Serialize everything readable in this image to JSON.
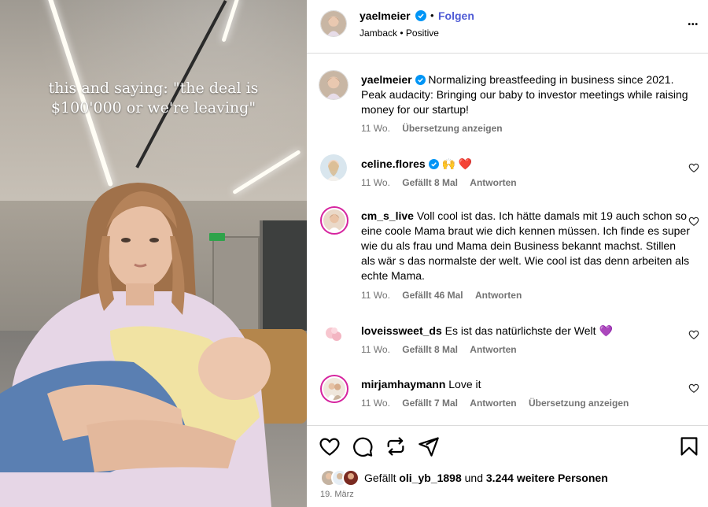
{
  "video": {
    "overlay_text": "this and saying: \"the deal is $100'000 or we're leaving\""
  },
  "header": {
    "username": "yaelmeier",
    "follow_label": "Folgen",
    "dot": "•",
    "audio_sub": "Jamback • Positive",
    "more_label": "•••"
  },
  "post": {
    "username": "yaelmeier",
    "caption": "Normalizing breastfeeding in business since 2021. Peak audacity: Bringing our baby to investor meetings while raising money for our startup!",
    "time": "11 Wo.",
    "translate": "Übersetzung anzeigen"
  },
  "comments": [
    {
      "username": "celine.flores",
      "text": "🙌 ❤️",
      "time": "11 Wo.",
      "likes": "Gefällt 8 Mal",
      "reply": "Antworten",
      "translate": ""
    },
    {
      "username": "cm_s_live",
      "text": "Voll cool ist das. Ich hätte damals mit 19 auch schon so eine coole Mama braut wie dich kennen müssen. Ich finde es super wie du als frau und Mama dein Business bekannt machst. Stillen als wär s das normalste der welt. Wie cool ist das denn arbeiten als echte Mama.",
      "time": "11 Wo.",
      "likes": "Gefällt 46 Mal",
      "reply": "Antworten",
      "translate": ""
    },
    {
      "username": "loveissweet_ds",
      "text": "Es ist das natürlichste der Welt 💜",
      "time": "11 Wo.",
      "likes": "Gefällt 8 Mal",
      "reply": "Antworten",
      "translate": ""
    },
    {
      "username": "mirjamhaymann",
      "text": "Love it",
      "time": "11 Wo.",
      "likes": "Gefällt 7 Mal",
      "reply": "Antworten",
      "translate": "Übersetzung anzeigen"
    }
  ],
  "likes": {
    "prefix": "Gefällt",
    "user": "oli_yb_1898",
    "middle": "und",
    "others": "3.244 weitere Personen"
  },
  "date": "19. März",
  "colors": {
    "verified": "#0095f6",
    "follow": "#4f5bd5",
    "muted": "#737373",
    "border": "#dbdbdb"
  },
  "icons": [
    "heart-icon",
    "comment-icon",
    "share-icon",
    "send-icon",
    "bookmark-icon",
    "verified-icon",
    "more-icon"
  ]
}
